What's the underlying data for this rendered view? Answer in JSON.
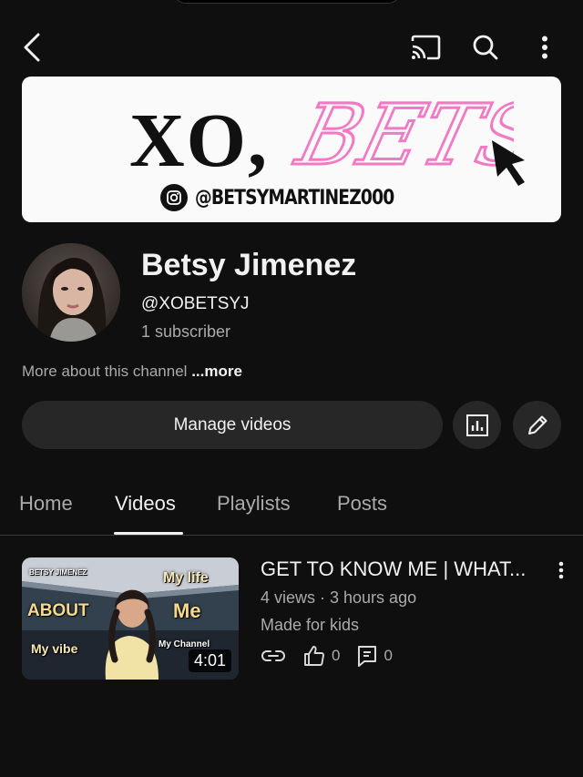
{
  "banner": {
    "title_left": "XO,",
    "title_right": "BETSY",
    "handle": "@BETSYMARTINEZ000",
    "accent_color": "#f07ac4"
  },
  "channel": {
    "name": "Betsy Jimenez",
    "handle": "@XOBETSYJ",
    "subscribers": "1 subscriber",
    "about": "More about this channel",
    "about_more": "...more"
  },
  "actions": {
    "manage_label": "Manage videos",
    "analytics_icon": "analytics-icon",
    "edit_icon": "pencil-icon"
  },
  "tabs": [
    {
      "label": "Home"
    },
    {
      "label": "Videos"
    },
    {
      "label": "Playlists"
    },
    {
      "label": "Posts"
    }
  ],
  "active_tab": "Videos",
  "video": {
    "title": "GET TO KNOW ME | WHAT...",
    "meta": "4 views · 3 hours ago",
    "audience": "Made for kids",
    "likes": "0",
    "comments": "0",
    "duration": "4:01",
    "thumb": {
      "label_name": "BETSY JIMENEZ",
      "label_about": "ABOUT",
      "label_my_life": "My life",
      "label_me": "Me",
      "label_my_vibe": "My vibe",
      "label_my_channel": "My Channel"
    }
  }
}
